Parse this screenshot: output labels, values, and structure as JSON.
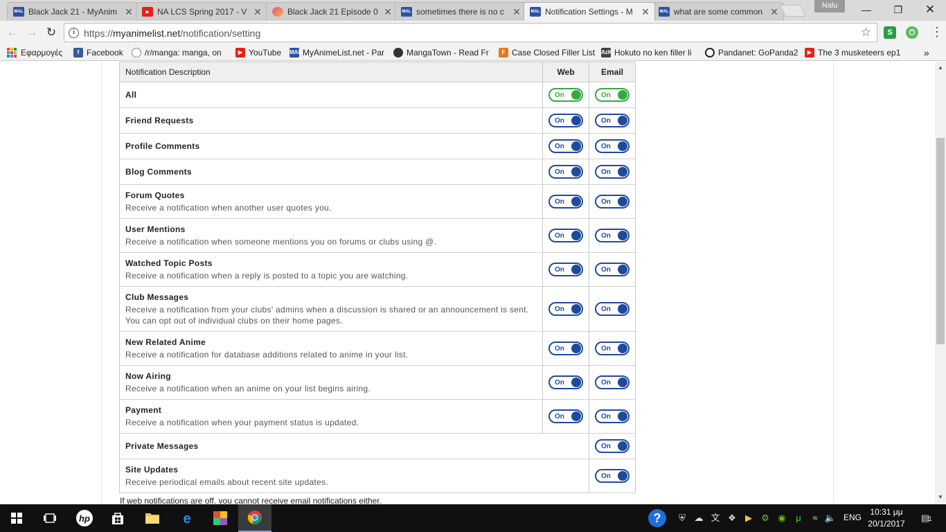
{
  "browser": {
    "tabs": [
      {
        "title": "Black Jack 21 - MyAnim",
        "icon": "mal-favicon-icon",
        "fav": "MAL",
        "favclass": "mal"
      },
      {
        "title": "NA LCS Spring 2017 - V",
        "icon": "youtube-favicon-icon",
        "fav": "▶",
        "favclass": "yt"
      },
      {
        "title": "Black Jack 21 Episode 0",
        "icon": "site-favicon-icon",
        "fav": "",
        "favclass": "bj"
      },
      {
        "title": "sometimes there is no c",
        "icon": "mal-favicon-icon",
        "fav": "MAL",
        "favclass": "mal"
      },
      {
        "title": "Notification Settings - M",
        "icon": "mal-favicon-icon",
        "fav": "MAL",
        "favclass": "mal",
        "active": true
      },
      {
        "title": "what are some common",
        "icon": "mal-favicon-icon",
        "fav": "MAL",
        "favclass": "mal"
      }
    ],
    "profile_name": "Nalu",
    "url_prefix": "https://",
    "url_host": "myanimelist.net",
    "url_path": "/notification/setting",
    "bookmarks": [
      {
        "label": "Εφαρμογές",
        "icon": "apps-grid-icon"
      },
      {
        "label": "Facebook",
        "icon": "facebook-icon"
      },
      {
        "label": "/r/manga: manga, on",
        "icon": "reddit-icon"
      },
      {
        "label": "YouTube",
        "icon": "youtube-icon"
      },
      {
        "label": "MyAnimeList.net - Par",
        "icon": "mal-icon"
      },
      {
        "label": "MangaTown - Read Fr",
        "icon": "mangatown-icon"
      },
      {
        "label": "Case Closed Filler List",
        "icon": "filler-list-icon"
      },
      {
        "label": "Hokuto no ken filler li",
        "icon": "azk-icon"
      },
      {
        "label": "Pandanet: GoPanda2",
        "icon": "panda-icon"
      },
      {
        "label": "The 3 musketeers ep1",
        "icon": "youtube-icon"
      }
    ]
  },
  "table": {
    "header_desc": "Notification Description",
    "header_web": "Web",
    "header_email": "Email",
    "rows": [
      {
        "title": "All",
        "sub": "",
        "web": "On",
        "email": "On",
        "green": true
      },
      {
        "title": "Friend Requests",
        "sub": "",
        "web": "On",
        "email": "On"
      },
      {
        "title": "Profile Comments",
        "sub": "",
        "web": "On",
        "email": "On"
      },
      {
        "title": "Blog Comments",
        "sub": "",
        "web": "On",
        "email": "On"
      },
      {
        "title": "Forum Quotes",
        "sub": "Receive a notification when another user quotes you.",
        "web": "On",
        "email": "On"
      },
      {
        "title": "User Mentions",
        "sub": "Receive a notification when someone mentions you on forums or clubs using @.",
        "web": "On",
        "email": "On"
      },
      {
        "title": "Watched Topic Posts",
        "sub": "Receive a notification when a reply is posted to a topic you are watching.",
        "web": "On",
        "email": "On"
      },
      {
        "title": "Club Messages",
        "sub": "Receive a notification from your clubs' admins when a discussion is shared or an announcement is sent.",
        "sub2": "You can opt out of individual clubs on their home pages.",
        "web": "On",
        "email": "On"
      },
      {
        "title": "New Related Anime",
        "sub": "Receive a notification for database additions related to anime in your list.",
        "web": "On",
        "email": "On"
      },
      {
        "title": "Now Airing",
        "sub": "Receive a notification when an anime on your list begins airing.",
        "web": "On",
        "email": "On"
      },
      {
        "title": "Payment",
        "sub": "Receive a notification when your payment status is updated.",
        "web": "On",
        "email": "On"
      },
      {
        "title": "Private Messages",
        "sub": "",
        "web": null,
        "email": "On"
      },
      {
        "title": "Site Updates",
        "sub": "Receive periodical emails about recent site updates.",
        "web": null,
        "email": "On"
      }
    ],
    "footnote": "If web notifications are off, you cannot receive email notifications either."
  },
  "taskbar": {
    "language": "ENG",
    "time": "10:31 μμ",
    "date": "20/1/2017",
    "notifications_count": "1"
  },
  "colors": {
    "toggle_on": "#1f4a9c",
    "toggle_all": "#33aa44"
  }
}
